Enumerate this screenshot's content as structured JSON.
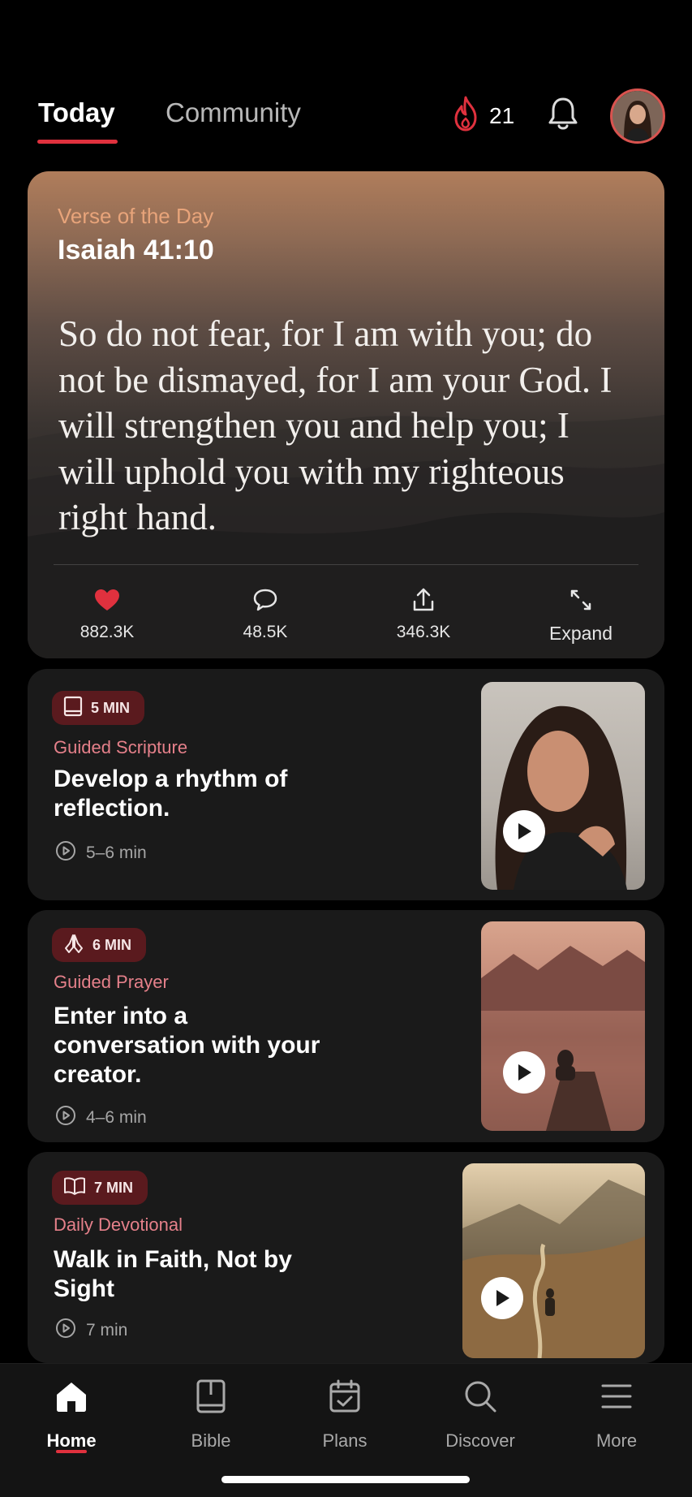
{
  "header": {
    "tabs": [
      {
        "label": "Today",
        "active": true
      },
      {
        "label": "Community",
        "active": false
      }
    ],
    "streak_count": "21",
    "icons": {
      "streak": "flame-icon",
      "notifications": "bell-icon",
      "profile": "avatar"
    }
  },
  "verse": {
    "kicker": "Verse of the Day",
    "reference": "Isaiah 41:10",
    "text": "So do not fear, for I am with you; do not be dismayed, for I am your God. I will strengthen you and help you; I will uphold you with my righteous right hand.",
    "actions": {
      "likes": "882.3K",
      "comments": "48.5K",
      "shares": "346.3K",
      "expand": "Expand"
    }
  },
  "cards": [
    {
      "badge": "5 MIN",
      "badge_icon": "book-icon",
      "kicker": "Guided Scripture",
      "title": "Develop a rhythm of reflection.",
      "duration": "5–6 min"
    },
    {
      "badge": "6 MIN",
      "badge_icon": "praying-hands-icon",
      "kicker": "Guided Prayer",
      "title": "Enter into a conversation with your creator.",
      "duration": "4–6 min"
    },
    {
      "badge": "7 MIN",
      "badge_icon": "open-book-icon",
      "kicker": "Daily Devotional",
      "title": "Walk in Faith, Not by Sight",
      "duration": "7 min"
    }
  ],
  "nav": {
    "items": [
      {
        "label": "Home",
        "icon": "home-icon",
        "active": true
      },
      {
        "label": "Bible",
        "icon": "bible-icon",
        "active": false
      },
      {
        "label": "Plans",
        "icon": "calendar-check-icon",
        "active": false
      },
      {
        "label": "Discover",
        "icon": "search-icon",
        "active": false
      },
      {
        "label": "More",
        "icon": "menu-icon",
        "active": false
      }
    ]
  },
  "colors": {
    "accent": "#e0313e",
    "badge_bg": "#5a1a1e",
    "kicker": "#e5808a",
    "background": "#000000",
    "card": "#1a1a1a"
  }
}
